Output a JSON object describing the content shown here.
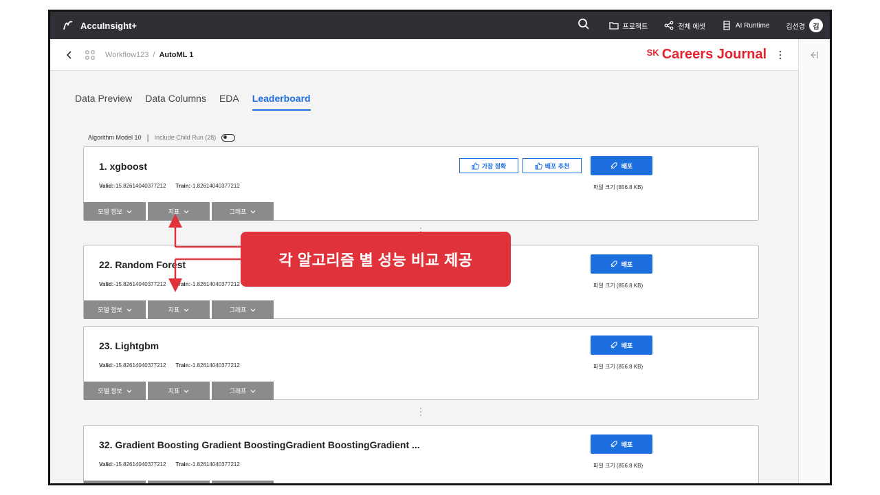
{
  "app": {
    "name": "AccuInsight+"
  },
  "topbar": {
    "items": [
      {
        "icon": "folder-icon",
        "label": "프로젝트"
      },
      {
        "icon": "share-icon",
        "label": "전체 에셋"
      },
      {
        "icon": "server-icon",
        "label": "AI Runtime"
      }
    ],
    "user_name": "김선경",
    "avatar_initial": "김"
  },
  "breadcrumb": {
    "parent": "Workflow123",
    "separator": "/",
    "current": "AutoML 1"
  },
  "brand": {
    "sk": "SK",
    "name": "Careers Journal"
  },
  "tabs": [
    "Data Preview",
    "Data Columns",
    "EDA",
    "Leaderboard"
  ],
  "active_tab": "Leaderboard",
  "algo_bar": {
    "model_count": "Algorithm Model 10",
    "divider": "|",
    "child_run": "Include Child Run (28)"
  },
  "common": {
    "valid_label": "Valid:",
    "valid_value": "-15.82614040377212",
    "train_label": "Train:",
    "train_value": "-1.82614040377212",
    "deploy_label": "배포",
    "filesize": "파일 크기 (856.8 KB)",
    "dropdowns": [
      "모델 정보",
      "지표",
      "그래프"
    ]
  },
  "cards": [
    {
      "title": "1. xgboost",
      "badges": [
        "가장 정확",
        "배포 추천"
      ]
    },
    {
      "title": "22. Random Forest"
    },
    {
      "title": "23. Lightgbm"
    },
    {
      "title": "32. Gradient Boosting Gradient BoostingGradient BoostingGradient ..."
    }
  ],
  "annotation": {
    "text": "각 알고리즘 별 성능 비교 제공",
    "color": "#e0323a"
  },
  "colors": {
    "accent": "#1d6fe0",
    "topbar": "#2f3035",
    "brand": "#e0232f",
    "dropdown": "#8b8b8b"
  }
}
